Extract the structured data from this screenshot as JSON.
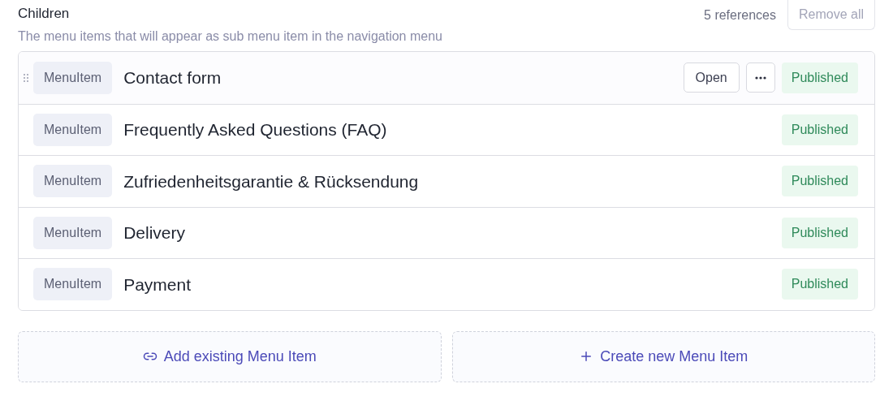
{
  "field": {
    "label": "Children",
    "description": "The menu items that will appear as sub menu item in the navigation menu",
    "count": "5 references",
    "remove_all": "Remove all"
  },
  "rows": [
    {
      "type": "MenuItem",
      "title": "Contact form",
      "status": "Published",
      "hovered": true,
      "open": "Open"
    },
    {
      "type": "MenuItem",
      "title": "Frequently Asked Questions (FAQ)",
      "status": "Published",
      "hovered": false
    },
    {
      "type": "MenuItem",
      "title": "Zufriedenheitsgarantie & Rücksendung",
      "status": "Published",
      "hovered": false
    },
    {
      "type": "MenuItem",
      "title": "Delivery",
      "status": "Published",
      "hovered": false
    },
    {
      "type": "MenuItem",
      "title": "Payment",
      "status": "Published",
      "hovered": false
    }
  ],
  "actions": [
    {
      "kind": "link",
      "label": "Add existing Menu Item"
    },
    {
      "kind": "create",
      "label": "Create new Menu Item"
    }
  ]
}
